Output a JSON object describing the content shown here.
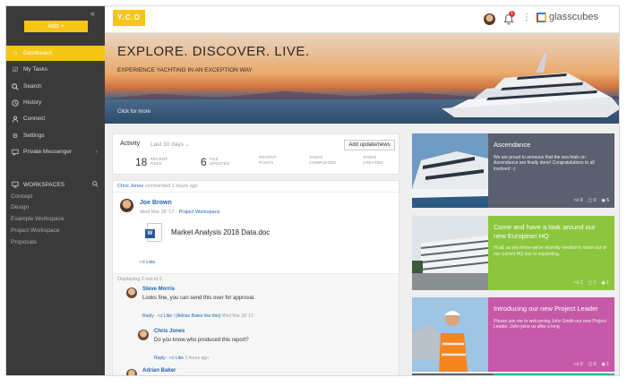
{
  "sidebar": {
    "add_label": "Add +",
    "nav": [
      {
        "label": "Dashboard",
        "icon": "home-icon",
        "active": true
      },
      {
        "label": "My Tasks",
        "icon": "checkbox-icon"
      },
      {
        "label": "Search",
        "icon": "search-icon"
      },
      {
        "label": "History",
        "icon": "clock-icon"
      },
      {
        "label": "Connect",
        "icon": "user-icon"
      },
      {
        "label": "Settings",
        "icon": "gear-icon"
      },
      {
        "label": "Private Messenger",
        "icon": "chat-icon"
      }
    ],
    "workspaces_label": "WORKSPACES",
    "workspaces": [
      "Concept",
      "Design",
      "Example Workspace",
      "Project Workspace",
      "Proposals"
    ]
  },
  "topbar": {
    "logo": "Y.C.O",
    "notification_count": "1",
    "brand": "glasscubes"
  },
  "hero": {
    "title": "EXPLORE. DISCOVER. LIVE.",
    "subtitle": "EXPERIENCE YACHTING IN AN EXCEPTION WAY",
    "link": "Click for more"
  },
  "activity": {
    "label": "Activity",
    "range": "Last 30 days",
    "add_button": "Add update/news",
    "stats": [
      {
        "value": "18",
        "label1": "RECENT",
        "label2": "FILES"
      },
      {
        "value": "6",
        "label1": "FILE",
        "label2": "UPDATES"
      },
      {
        "value": "",
        "label1": "RECENT",
        "label2": "POSTS"
      },
      {
        "value": "",
        "label1": "TASKS",
        "label2": "COMPLETED"
      },
      {
        "value": "",
        "label1": "TASKS",
        "label2": "CREATED"
      }
    ]
  },
  "feed": {
    "header_name": "Chris Jones",
    "header_text": "commented 1 hours ago",
    "post": {
      "author": "Joe Brown",
      "date": "Wed Mar 28 '17",
      "workspace": "Project Workspace",
      "file": "Market Analysis 2018 Data.doc",
      "like": "Like"
    },
    "displaying": "Displaying 2 out of 2",
    "comments": [
      {
        "name": "Steve Morris",
        "text": "Looks fine, you can send this over for approval.",
        "reply": "Reply",
        "like": "Like",
        "liked_by": "Adrian Baker like this",
        "date": "Wed Mar 28 '17"
      },
      {
        "name": "Chris Jones",
        "text": "Do you know who produced this report?",
        "reply": "Reply",
        "like": "Like",
        "date": "1 hours ago"
      },
      {
        "name": "Adrian Baker"
      }
    ]
  },
  "cards": [
    {
      "title": "Ascendance",
      "text": "We are proud to annouce that the sea trials on Ascendance are finally done! Congratulations to all involved :-)",
      "likes": "0",
      "comments": "0",
      "views": "5",
      "color": "#5a6070"
    },
    {
      "title": "Come and have a look around our new European HQ",
      "text": "Hi all, as you know we've recently needed to move out of our current HQ due to expanding.",
      "likes": "1",
      "comments": "1",
      "views": "1",
      "color": "#8cc63f"
    },
    {
      "title": "Introducing our new Project Leader",
      "text": "Please join me to welcoming John Smith our new Project Leader. John joins us after a long",
      "likes": "0",
      "comments": "0",
      "views": "1",
      "color": "#c65aa8"
    }
  ]
}
